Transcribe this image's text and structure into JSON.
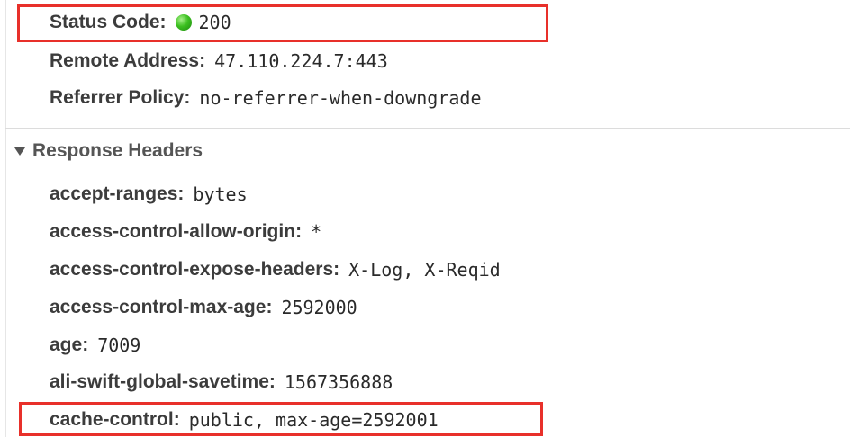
{
  "general": {
    "status": {
      "key": "Status Code",
      "value": "200",
      "indicator_color": "#2bb514"
    },
    "remote_address": {
      "key": "Remote Address",
      "value": "47.110.224.7:443"
    },
    "referrer_policy": {
      "key": "Referrer Policy",
      "value": "no-referrer-when-downgrade"
    }
  },
  "response_headers": {
    "title": "Response Headers",
    "expanded": true,
    "items": [
      {
        "key": "accept-ranges",
        "value": "bytes"
      },
      {
        "key": "access-control-allow-origin",
        "value": "*"
      },
      {
        "key": "access-control-expose-headers",
        "value": "X-Log, X-Reqid"
      },
      {
        "key": "access-control-max-age",
        "value": "2592000"
      },
      {
        "key": "age",
        "value": "7009"
      },
      {
        "key": "ali-swift-global-savetime",
        "value": "1567356888"
      },
      {
        "key": "cache-control",
        "value": "public, max-age=2592001"
      }
    ]
  },
  "annotation_color": "#e8302a"
}
